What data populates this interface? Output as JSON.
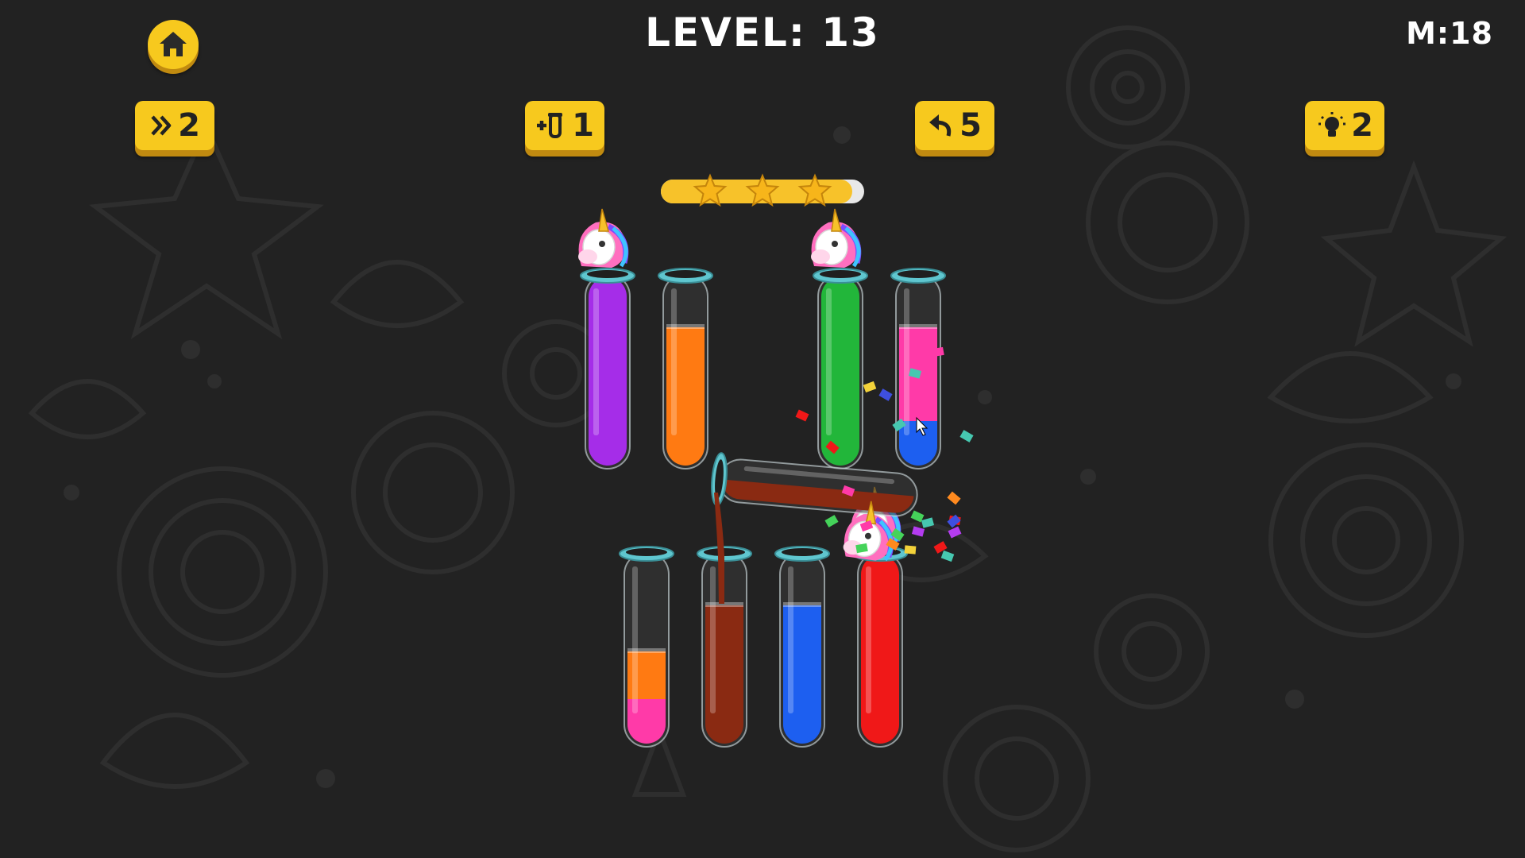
{
  "hud": {
    "level_label": "LEVEL: 13",
    "moves_label": "M:18"
  },
  "buttons": {
    "skip": {
      "icon": "double-chevron-right-icon",
      "count": "2"
    },
    "add_tube": {
      "icon": "add-tube-icon",
      "count": "1"
    },
    "undo": {
      "icon": "undo-arrow-icon",
      "count": "5"
    },
    "hint": {
      "icon": "lightbulb-icon",
      "count": "2"
    },
    "home": {
      "icon": "home-icon"
    }
  },
  "progress": {
    "fraction": 0.94,
    "stars": 3
  },
  "colors": {
    "purple": "#a52de8",
    "orange": "#ff7a12",
    "green": "#22b63a",
    "pink": "#ff3aa8",
    "blue": "#1d5ff0",
    "brown": "#8a2a12",
    "red": "#f01818",
    "accent": "#f7c91e",
    "tube_rim": "#5fc6cf"
  },
  "tubes": [
    {
      "name": "tube-1",
      "layers": [
        "purple",
        "purple",
        "purple",
        "purple"
      ],
      "completed": true
    },
    {
      "name": "tube-2",
      "layers": [
        "orange",
        "orange",
        "orange"
      ],
      "completed": false
    },
    {
      "name": "tube-3",
      "layers": [
        "green",
        "green",
        "green",
        "green"
      ],
      "completed": true
    },
    {
      "name": "tube-4",
      "layers": [
        "blue",
        "pink",
        "pink"
      ],
      "completed": false
    },
    {
      "name": "tube-5",
      "layers": [
        "pink",
        "orange"
      ],
      "completed": false
    },
    {
      "name": "tube-6",
      "layers": [
        "brown",
        "brown",
        "brown"
      ],
      "completed": false
    },
    {
      "name": "tube-7",
      "layers": [
        "blue",
        "blue",
        "blue"
      ],
      "completed": false
    },
    {
      "name": "tube-8",
      "layers": [
        "red",
        "red",
        "red",
        "red"
      ],
      "completed": true
    }
  ],
  "pouring_tube": {
    "layers": [
      "brown"
    ],
    "target": "tube-6"
  }
}
